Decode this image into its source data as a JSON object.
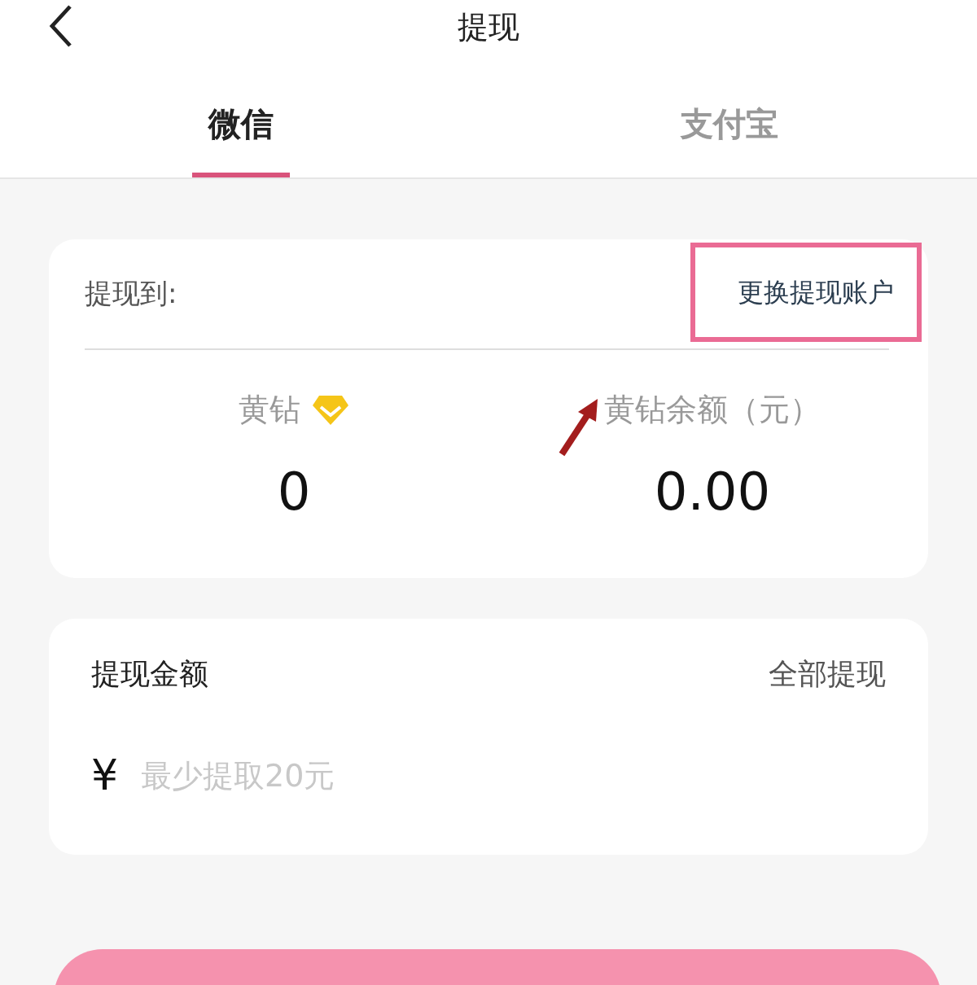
{
  "header": {
    "title": "提现"
  },
  "tabs": [
    {
      "label": "微信",
      "selected": true
    },
    {
      "label": "支付宝",
      "selected": false
    }
  ],
  "account_card": {
    "label": "提现到:",
    "change_link": "更换提现账户",
    "stats": [
      {
        "label": "黄钻",
        "value": "0"
      },
      {
        "label": "黄钻余额（元）",
        "value": "0.00"
      }
    ]
  },
  "amount_card": {
    "title": "提现金额",
    "withdraw_all": "全部提现",
    "currency": "¥",
    "placeholder": "最少提取20元"
  }
}
